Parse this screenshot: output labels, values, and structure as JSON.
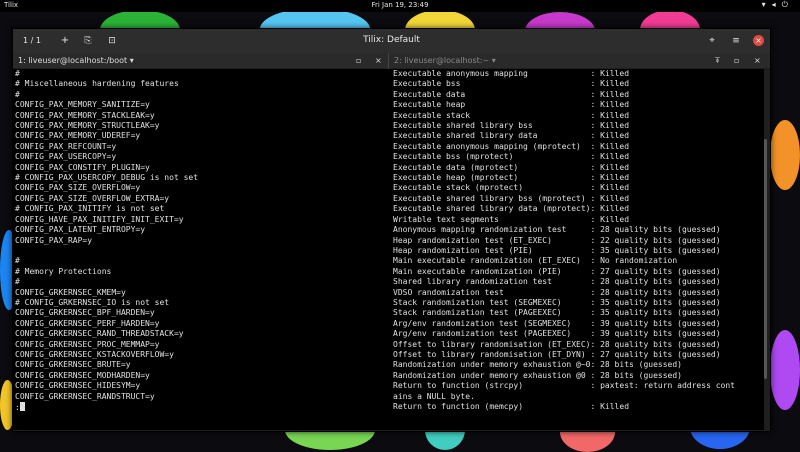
{
  "system_bar": {
    "app_name": "Tilix",
    "clock": "Fri Jan 19, 23:49",
    "tray_icons": [
      "network-icon",
      "volume-icon",
      "power-icon"
    ]
  },
  "window": {
    "title": "Tilix: Default",
    "session_counter": "1 / 1",
    "buttons": [
      "add-terminal-icon",
      "split-icon",
      "sidebar-icon",
      "find-icon",
      "menu-icon",
      "close-icon"
    ]
  },
  "left_pane": {
    "label": "1: liveuser@localhost:/boot",
    "lines": [
      "#",
      "# Miscellaneous hardening features",
      "#",
      "CONFIG_PAX_MEMORY_SANITIZE=y",
      "CONFIG_PAX_MEMORY_STACKLEAK=y",
      "CONFIG_PAX_MEMORY_STRUCTLEAK=y",
      "CONFIG_PAX_MEMORY_UDEREF=y",
      "CONFIG_PAX_REFCOUNT=y",
      "CONFIG_PAX_USERCOPY=y",
      "CONFIG_PAX_CONSTIFY_PLUGIN=y",
      "# CONFIG_PAX_USERCOPY_DEBUG is not set",
      "CONFIG_PAX_SIZE_OVERFLOW=y",
      "CONFIG_PAX_SIZE_OVERFLOW_EXTRA=y",
      "# CONFIG_PAX_INITIFY is not set",
      "CONFIG_HAVE_PAX_INITIFY_INIT_EXIT=y",
      "CONFIG_PAX_LATENT_ENTROPY=y",
      "CONFIG_PAX_RAP=y",
      "",
      "#",
      "# Memory Protections",
      "#",
      "CONFIG_GRKERNSEC_KMEM=y",
      "# CONFIG_GRKERNSEC_IO is not set",
      "CONFIG_GRKERNSEC_BPF_HARDEN=y",
      "CONFIG_GRKERNSEC_PERF_HARDEN=y",
      "CONFIG_GRKERNSEC_RAND_THREADSTACK=y",
      "CONFIG_GRKERNSEC_PROC_MEMMAP=y",
      "CONFIG_GRKERNSEC_KSTACKOVERFLOW=y",
      "CONFIG_GRKERNSEC_BRUTE=y",
      "CONFIG_GRKERNSEC_MODHARDEN=y",
      "CONFIG_GRKERNSEC_HIDESYM=y",
      "CONFIG_GRKERNSEC_RANDSTRUCT=y",
      ":"
    ]
  },
  "right_pane": {
    "label": "2: liveuser@localhost:~",
    "lines": [
      "Executable anonymous mapping             : Killed",
      "Executable bss                           : Killed",
      "Executable data                          : Killed",
      "Executable heap                          : Killed",
      "Executable stack                         : Killed",
      "Executable shared library bss            : Killed",
      "Executable shared library data           : Killed",
      "Executable anonymous mapping (mprotect)  : Killed",
      "Executable bss (mprotect)                : Killed",
      "Executable data (mprotect)               : Killed",
      "Executable heap (mprotect)               : Killed",
      "Executable stack (mprotect)              : Killed",
      "Executable shared library bss (mprotect) : Killed",
      "Executable shared library data (mprotect): Killed",
      "Writable text segments                   : Killed",
      "Anonymous mapping randomization test     : 28 quality bits (guessed)",
      "Heap randomization test (ET_EXEC)        : 22 quality bits (guessed)",
      "Heap randomization test (PIE)            : 35 quality bits (guessed)",
      "Main executable randomization (ET_EXEC)  : No randomization",
      "Main executable randomization (PIE)      : 27 quality bits (guessed)",
      "Shared library randomization test        : 28 quality bits (guessed)",
      "VDSO randomization test                  : 28 quality bits (guessed)",
      "Stack randomization test (SEGMEXEC)      : 35 quality bits (guessed)",
      "Stack randomization test (PAGEEXEC)      : 35 quality bits (guessed)",
      "Arg/env randomization test (SEGMEXEC)    : 39 quality bits (guessed)",
      "Arg/env randomization test (PAGEEXEC)    : 39 quality bits (guessed)",
      "Offset to library randomisation (ET_EXEC): 28 quality bits (guessed)",
      "Offset to library randomisation (ET_DYN) : 27 quality bits (guessed)",
      "Randomization under memory exhaustion @~0: 28 bits (guessed)",
      "Randomization under memory exhaustion @0 : 28 bits (guessed)",
      "Return to function (strcpy)              : paxtest: return address cont",
      "ains a NULL byte.",
      "Return to function (memcpy)              : Killed"
    ]
  }
}
